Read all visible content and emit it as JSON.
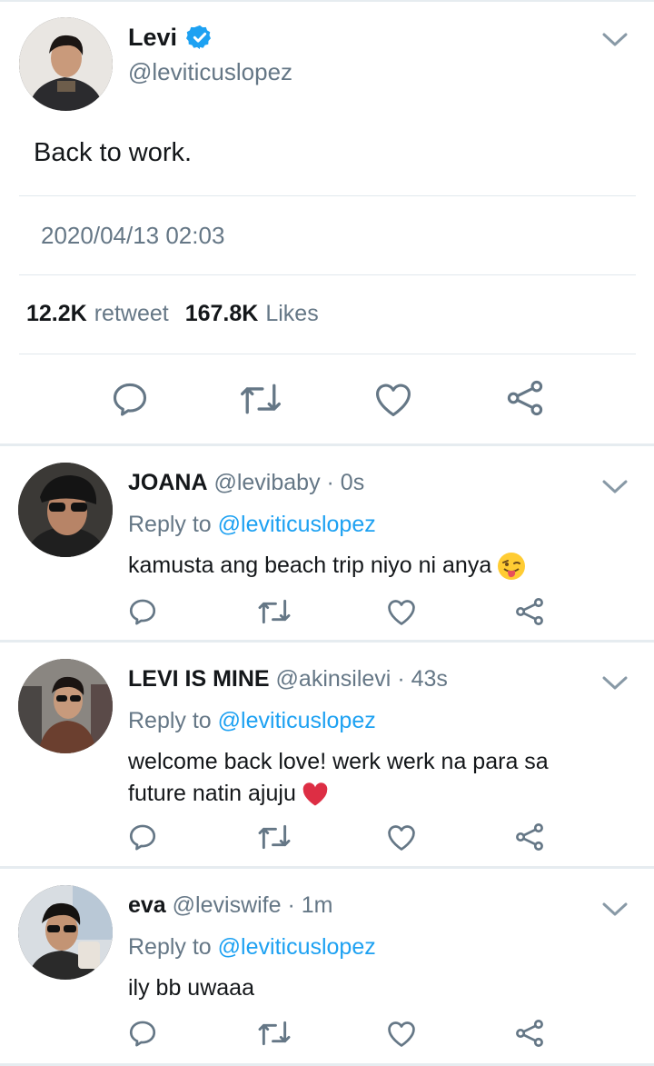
{
  "main_tweet": {
    "name": "Levi",
    "handle": "@leviticuslopez",
    "text": "Back to work.",
    "timestamp": "2020/04/13 02:03",
    "retweets": "12.2K",
    "retweet_label": "retweet",
    "likes": "167.8K",
    "likes_label": "Likes",
    "verified": true
  },
  "replies": [
    {
      "name": "JOANA",
      "handle": "@levibaby",
      "time": "· 0s",
      "reply_to_label": "Reply to",
      "reply_to": "@leviticuslopez",
      "text": "kamusta ang beach trip niyo ni anya",
      "emoji": "winking-tongue-face"
    },
    {
      "name": "LEVI IS MINE",
      "handle": "@akinsilevi",
      "time": "· 43s",
      "reply_to_label": "Reply to",
      "reply_to": "@leviticuslopez",
      "text": "welcome back love! werk werk na para sa future natin ajuju",
      "emoji": "red-heart"
    },
    {
      "name": "eva",
      "handle": "@leviswife",
      "time": "· 1m",
      "reply_to_label": "Reply to",
      "reply_to": "@leviticuslopez",
      "text": "ily bb uwaaa",
      "emoji": ""
    }
  ],
  "colors": {
    "link": "#1da1f2",
    "secondary_text": "#657786",
    "icon": "#657786",
    "divider": "#e1e8ed"
  }
}
